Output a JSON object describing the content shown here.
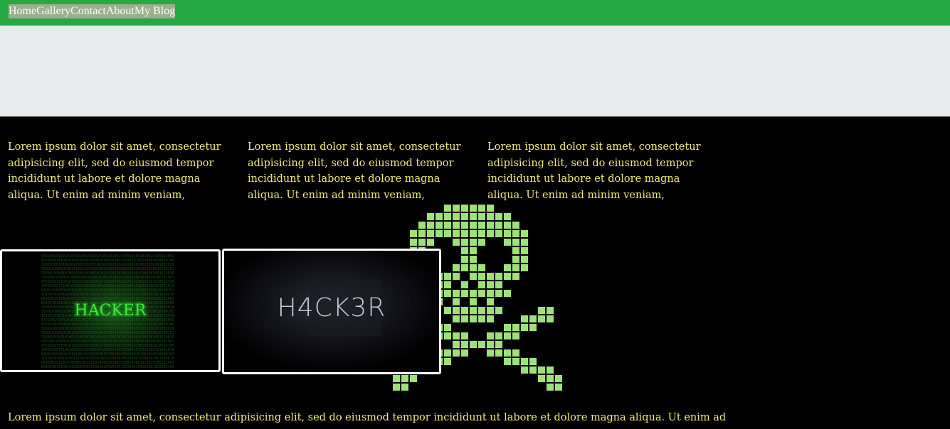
{
  "nav": {
    "items": [
      "Home",
      "Gallery",
      "Contact",
      "About",
      "My Blog"
    ]
  },
  "columns": [
    "Lorem ipsum dolor sit amet, consectetur adipisicing elit, sed do eiusmod tempor incididunt ut labore et dolore magna aliqua. Ut enim ad minim veniam,",
    "Lorem ipsum dolor sit amet, consectetur adipisicing elit, sed do eiusmod tempor incididunt ut labore et dolore magna aliqua. Ut enim ad minim veniam,",
    "Lorem ipsum dolor sit amet, consectetur adipisicing elit, sed do eiusmod tempor incididunt ut labore et dolore magna aliqua. Ut enim ad minim veniam,"
  ],
  "gallery": {
    "image1_text": "HACKER",
    "image2_text": "H4CK3R"
  },
  "footer_text": "Lorem ipsum dolor sit amet, consectetur adipisicing elit, sed do eiusmod tempor incididunt ut labore et dolore magna aliqua. Ut enim ad",
  "colors": {
    "nav_bg": "#26a845",
    "hero_bg": "#e8ebee",
    "text_yellow": "#f1eb7a",
    "skull_green": "#9fe07a"
  }
}
